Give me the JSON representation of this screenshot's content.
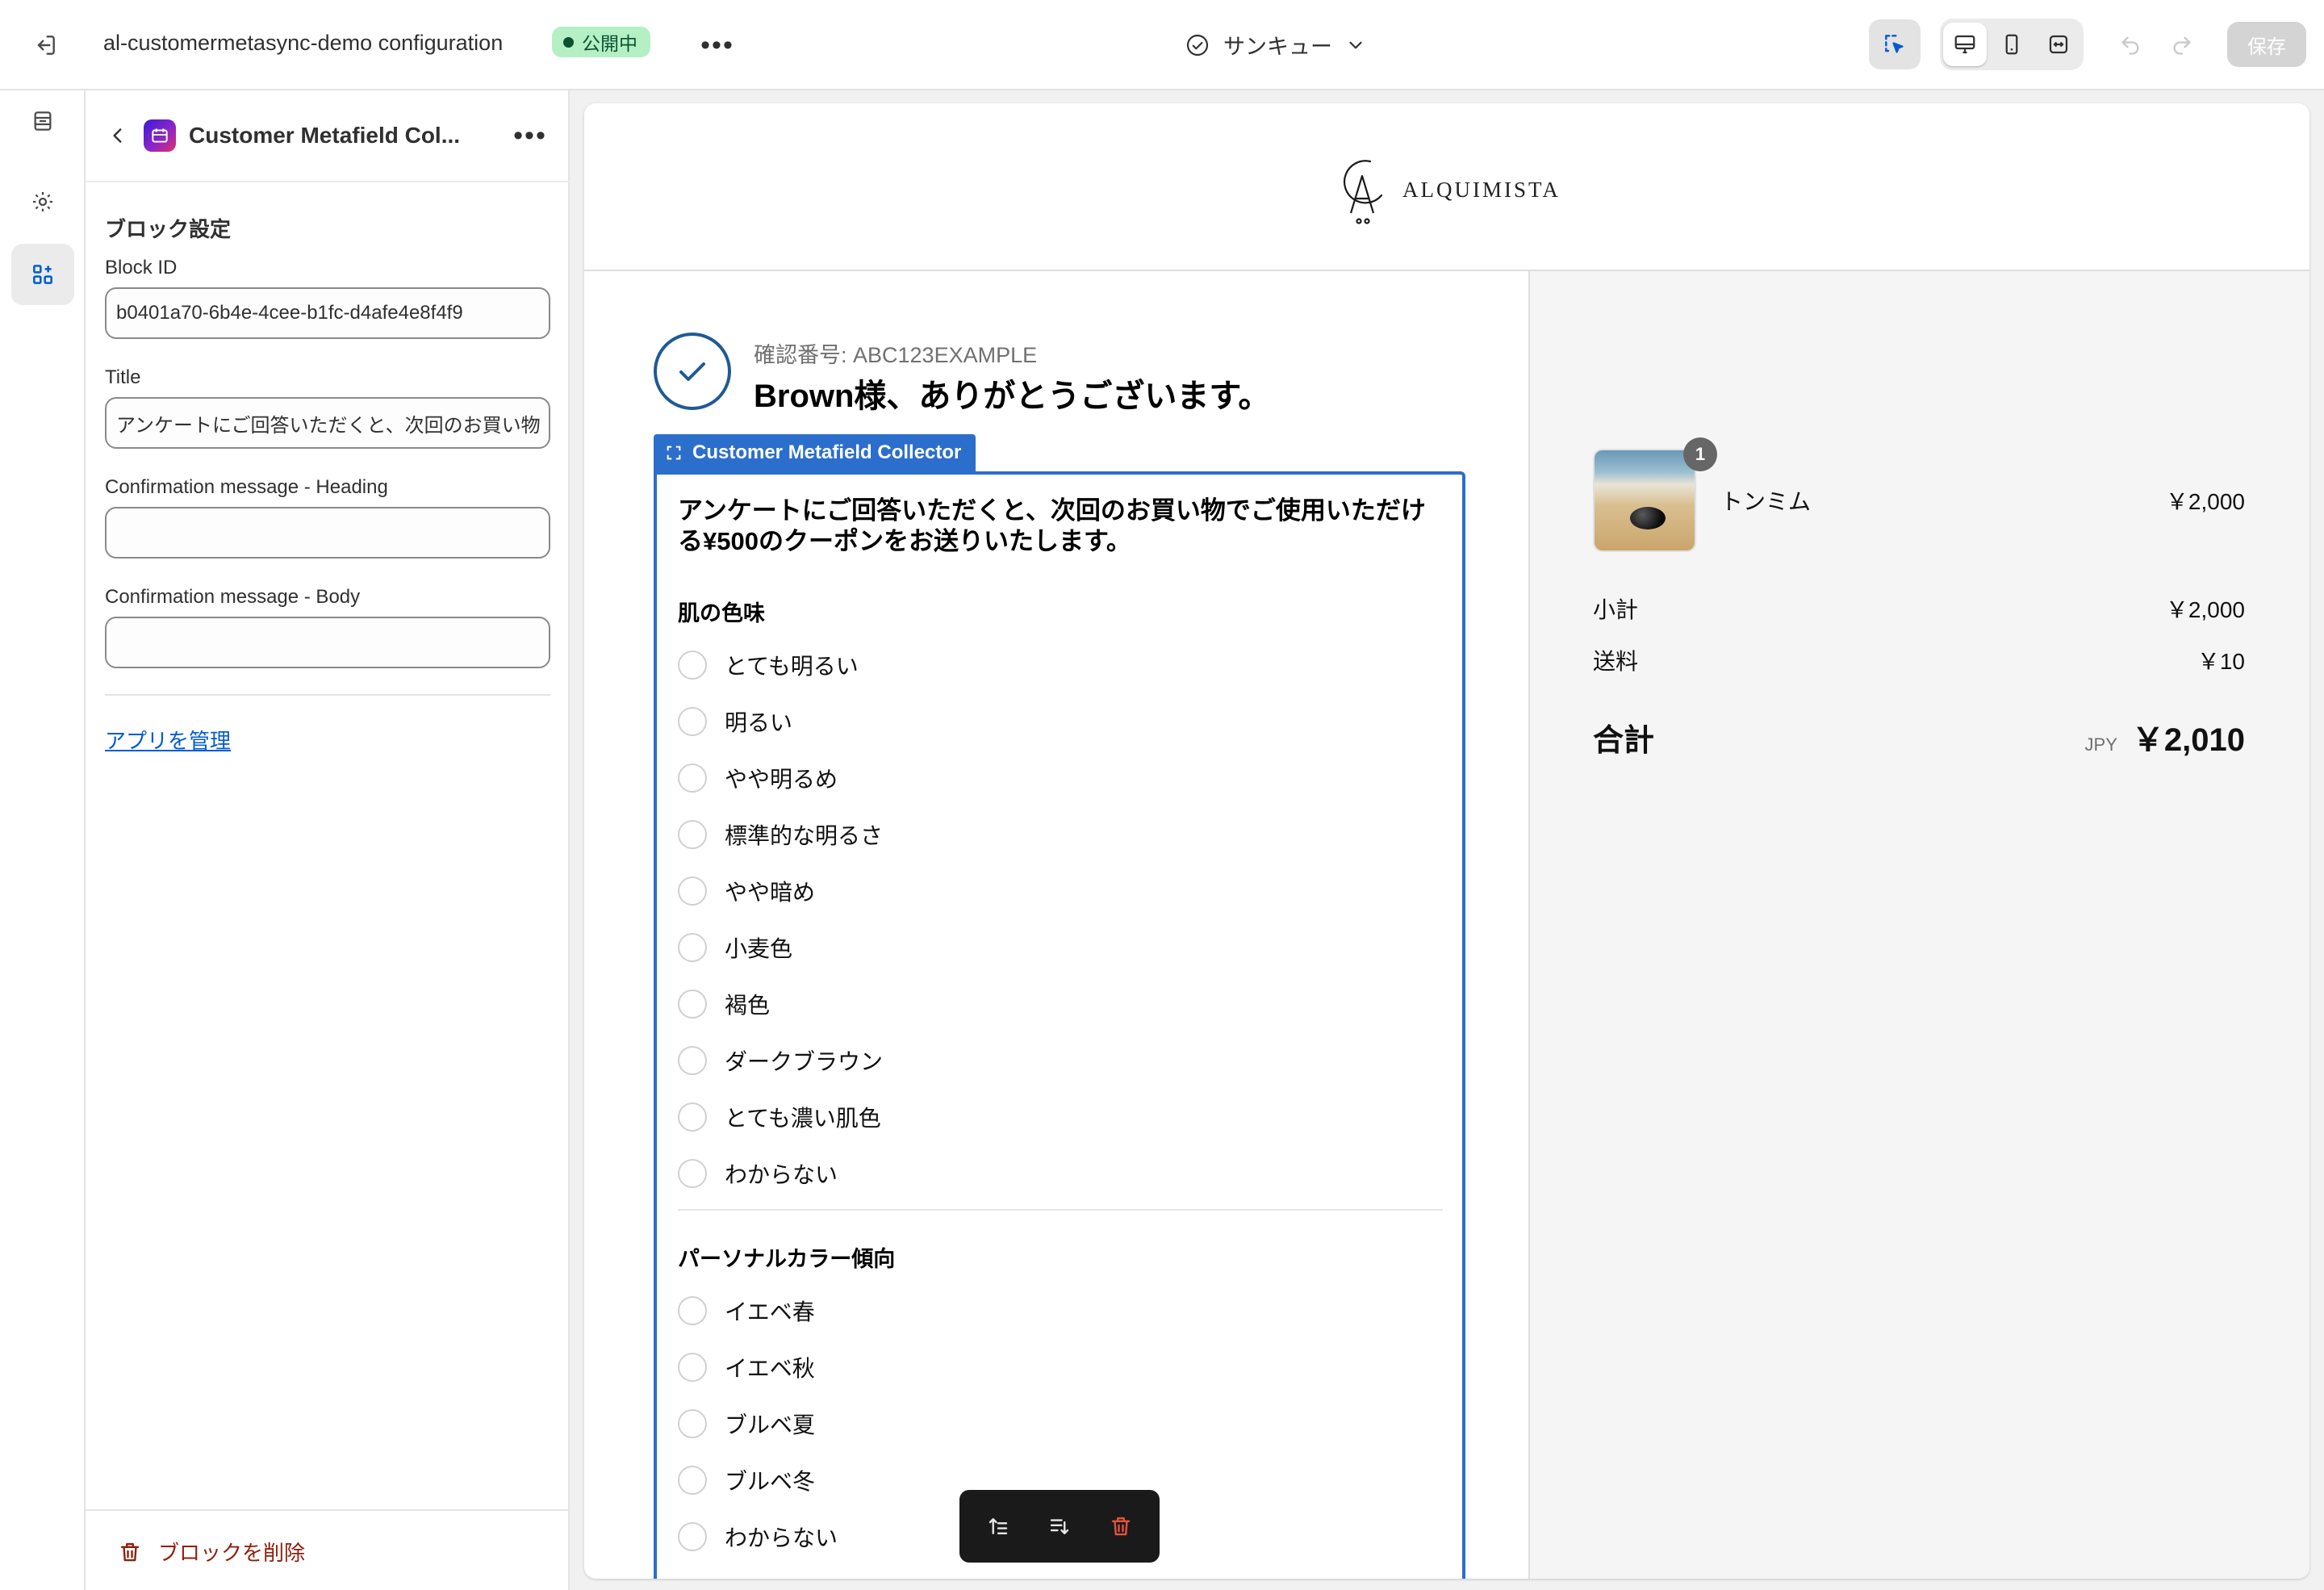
{
  "topbar": {
    "app_title": "al-customermetasync-demo configuration",
    "status_badge": "公開中",
    "more_label": "•••",
    "page_selector": "サンキュー",
    "save_label": "保存"
  },
  "panel": {
    "title": "Customer Metafield Col...",
    "more_label": "•••",
    "section_title": "ブロック設定",
    "fields": [
      {
        "label": "Block ID",
        "value": "b0401a70-6b4e-4cee-b1fc-d4afe4e8f4f9"
      },
      {
        "label": "Title",
        "value": "アンケートにご回答いただくと、次回のお買い物"
      },
      {
        "label": "Confirmation message - Heading",
        "value": ""
      },
      {
        "label": "Confirmation message - Body",
        "value": ""
      }
    ],
    "manage_app_link": "アプリを管理",
    "delete_label": "ブロックを削除"
  },
  "preview": {
    "brand": "ALQUIMISTA",
    "confirmation_number": "確認番号: ABC123EXAMPLE",
    "thank_you": "Brown様、ありがとうございます。",
    "block_tag": "Customer Metafield Collector",
    "intro": "アンケートにご回答いただくと、次回のお買い物でご使用いただける¥500のクーポンをお送りいたします。",
    "questions": [
      {
        "title": "肌の色味",
        "options": [
          "とても明るい",
          "明るい",
          "やや明るめ",
          "標準的な明るさ",
          "やや暗め",
          "小麦色",
          "褐色",
          "ダークブラウン",
          "とても濃い肌色",
          "わからない"
        ]
      },
      {
        "title": "パーソナルカラー傾向",
        "options": [
          "イエベ春",
          "イエベ秋",
          "ブルベ夏",
          "ブルベ冬",
          "わからない"
        ]
      }
    ],
    "summary": {
      "quantity": "1",
      "product_name": "トンミム",
      "product_price": "￥2,000",
      "subtotal_label": "小計",
      "subtotal_value": "￥2,000",
      "shipping_label": "送料",
      "shipping_value": "￥10",
      "total_label": "合計",
      "currency": "JPY",
      "total_value": "￥2,010"
    }
  },
  "colors": {
    "accent": "#2c6ecb",
    "badge_bg": "#b4f0c3",
    "link": "#005bd3",
    "danger": "#8e1f0b"
  }
}
